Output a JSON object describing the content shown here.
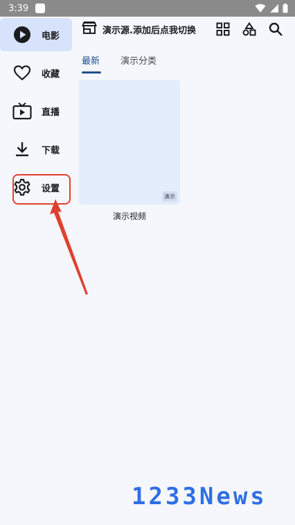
{
  "status_bar": {
    "time": "3:39"
  },
  "sidebar": {
    "items": [
      {
        "label": "电影",
        "icon": "play-icon",
        "active": true
      },
      {
        "label": "收藏",
        "icon": "heart-icon",
        "active": false
      },
      {
        "label": "直播",
        "icon": "tv-icon",
        "active": false
      },
      {
        "label": "下载",
        "icon": "download-icon",
        "active": false
      },
      {
        "label": "设置",
        "icon": "gear-icon",
        "active": false
      }
    ]
  },
  "topbar": {
    "source_label": "演示源.添加后点我切换",
    "icons": [
      "grid-icon",
      "shapes-icon",
      "search-icon"
    ]
  },
  "tabs": [
    {
      "label": "最新",
      "active": true
    },
    {
      "label": "演示分类",
      "active": false
    }
  ],
  "videos": [
    {
      "title": "演示视频",
      "badge": "演示"
    }
  ],
  "watermark": "1233News",
  "colors": {
    "accent": "#234f8a",
    "active_bg": "#d6e3fb",
    "highlight": "#e0402f",
    "poster_bg": "#e3edfc"
  }
}
